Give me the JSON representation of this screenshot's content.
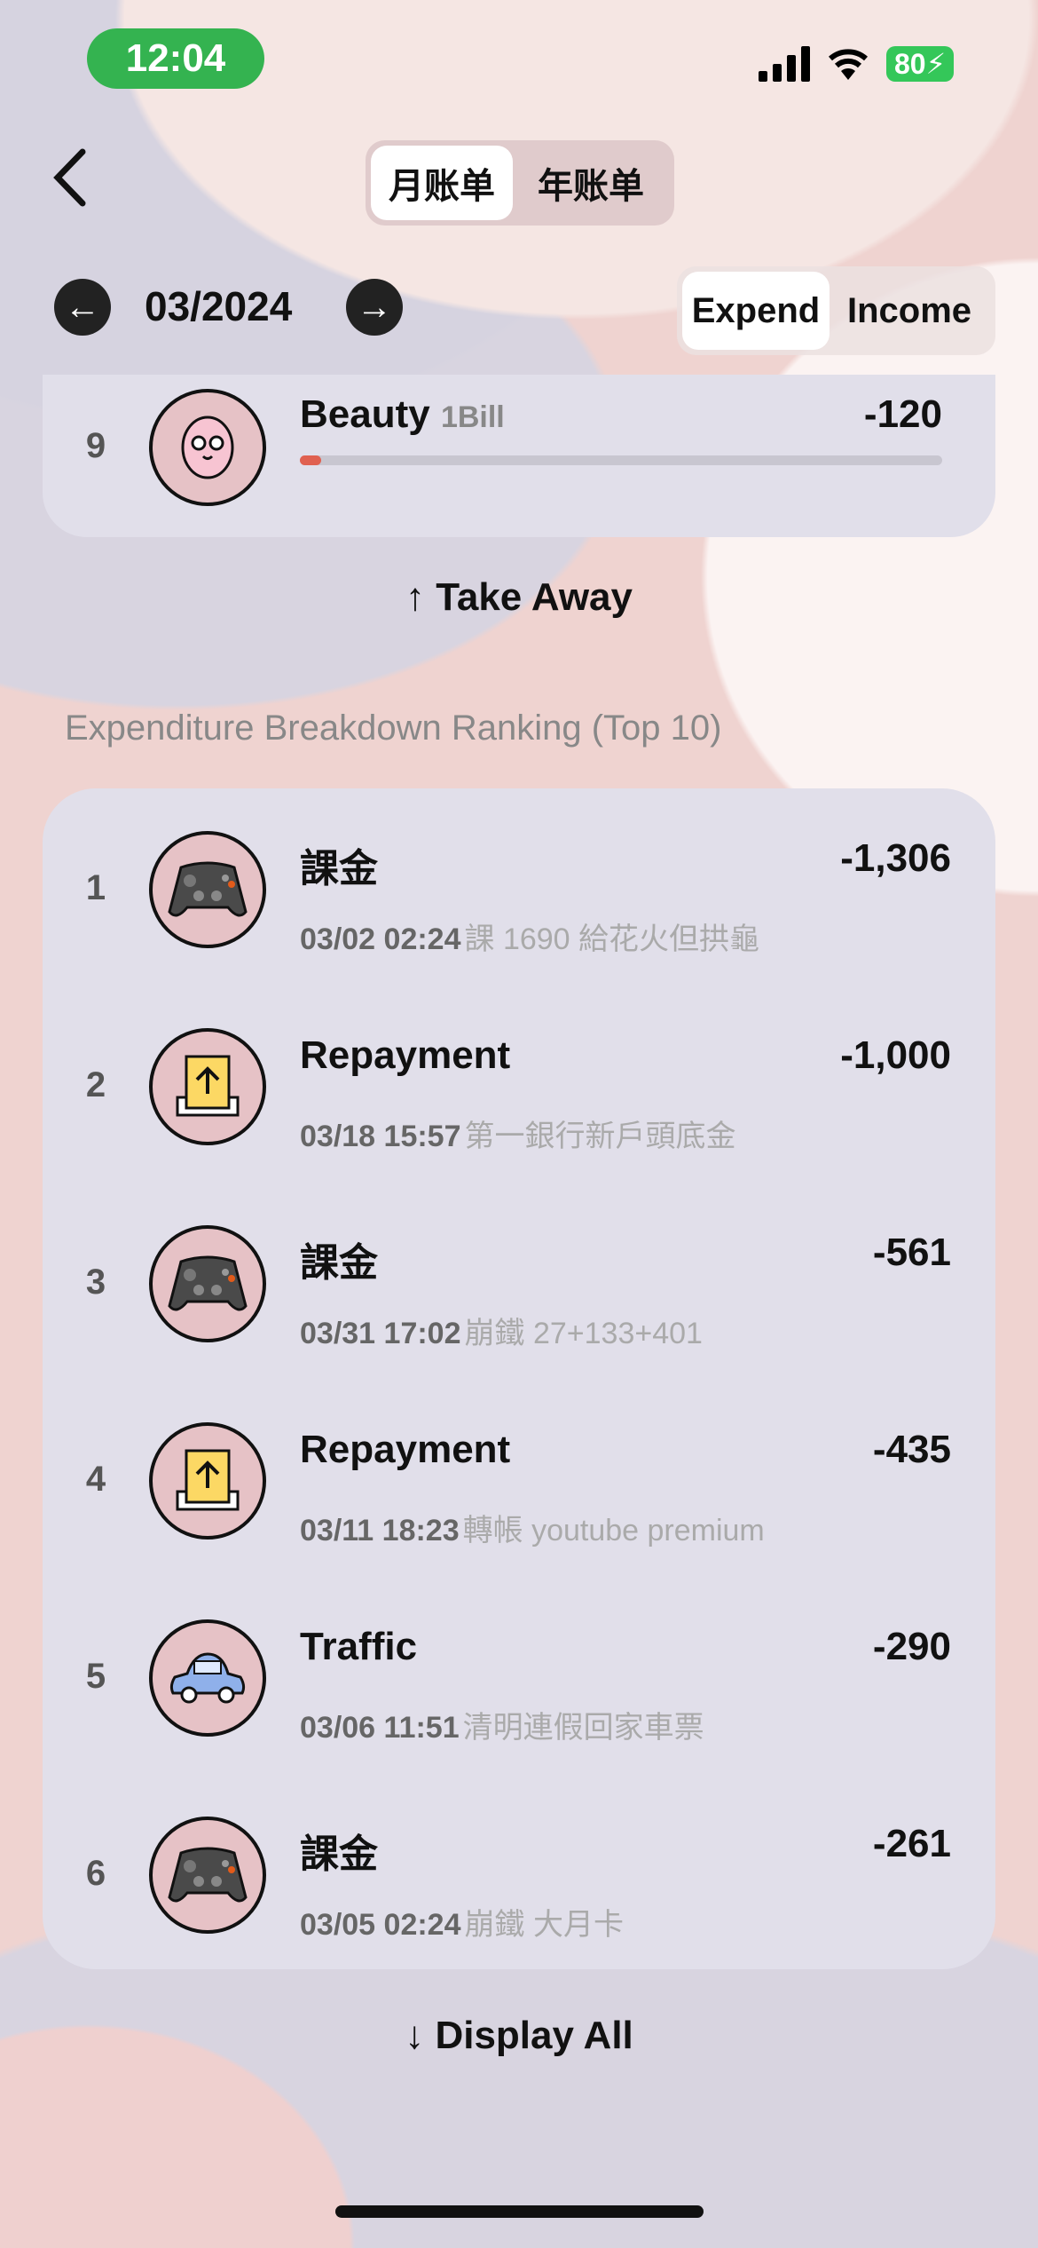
{
  "status_bar": {
    "time": "12:04",
    "battery": "80",
    "colors": {
      "time_pill": "#34b350"
    }
  },
  "header": {
    "back_icon": "chevron-left-icon",
    "tabs": [
      {
        "label": "月账单",
        "selected": true
      },
      {
        "label": "年账单",
        "selected": false
      }
    ]
  },
  "period": {
    "date": "03/2024",
    "prev_icon": "arrow-left-icon",
    "next_icon": "arrow-right-icon"
  },
  "type_toggle": [
    {
      "label": "Expend",
      "selected": true
    },
    {
      "label": "Income",
      "selected": false
    }
  ],
  "top_card": {
    "rank": "9",
    "icon": "beauty-face-icon",
    "title": "Beauty",
    "count": "1Bill",
    "amount": "-120",
    "progress": 0.02,
    "bar_color": "#e06050"
  },
  "take_away": {
    "label": "Take Away",
    "icon": "arrow-up-icon"
  },
  "ranking": {
    "heading": "Expenditure Breakdown Ranking (Top 10)",
    "items": [
      {
        "rank": "1",
        "icon": "game-controller-icon",
        "title": "課金",
        "time": "03/02 02:24",
        "note": "課 1690 給花火但拱龜",
        "amount": "-1,306"
      },
      {
        "rank": "2",
        "icon": "repayment-upload-icon",
        "title": "Repayment",
        "time": "03/18 15:57",
        "note": "第一銀行新戶頭底金",
        "amount": "-1,000"
      },
      {
        "rank": "3",
        "icon": "game-controller-icon",
        "title": "課金",
        "time": "03/31 17:02",
        "note": "崩鐵 27+133+401",
        "amount": "-561"
      },
      {
        "rank": "4",
        "icon": "repayment-upload-icon",
        "title": "Repayment",
        "time": "03/11 18:23",
        "note": "轉帳 youtube premium",
        "amount": "-435"
      },
      {
        "rank": "5",
        "icon": "car-icon",
        "title": "Traffic",
        "time": "03/06 11:51",
        "note": "清明連假回家車票",
        "amount": "-290"
      },
      {
        "rank": "6",
        "icon": "game-controller-icon",
        "title": "課金",
        "time": "03/05 02:24",
        "note": "崩鐵 大月卡",
        "amount": "-261"
      }
    ]
  },
  "display_all": {
    "label": "Display All",
    "icon": "arrow-down-icon"
  }
}
